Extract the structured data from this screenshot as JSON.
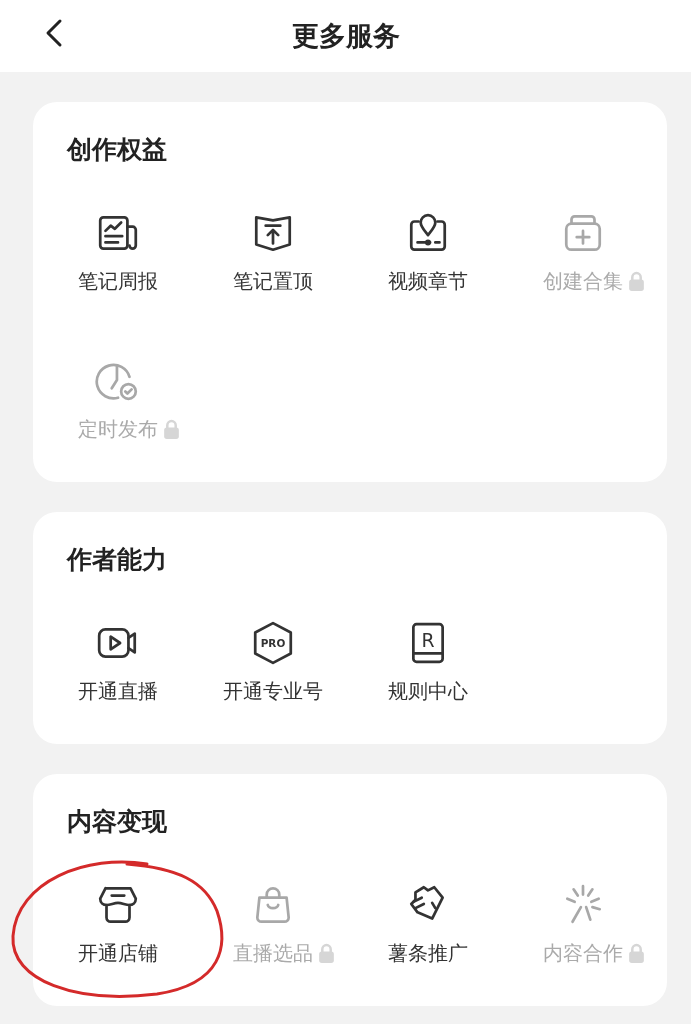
{
  "header": {
    "title": "更多服务"
  },
  "sections": [
    {
      "title": "创作权益",
      "items": [
        {
          "label": "笔记周报",
          "locked": false
        },
        {
          "label": "笔记置顶",
          "locked": false
        },
        {
          "label": "视频章节",
          "locked": false
        },
        {
          "label": "创建合集",
          "locked": true
        },
        {
          "label": "定时发布",
          "locked": true
        }
      ]
    },
    {
      "title": "作者能力",
      "items": [
        {
          "label": "开通直播",
          "locked": false
        },
        {
          "label": "开通专业号",
          "locked": false,
          "badge": "PRO"
        },
        {
          "label": "规则中心",
          "locked": false,
          "badge": "R"
        }
      ]
    },
    {
      "title": "内容变现",
      "items": [
        {
          "label": "开通店铺",
          "locked": false
        },
        {
          "label": "直播选品",
          "locked": true
        },
        {
          "label": "薯条推广",
          "locked": false
        },
        {
          "label": "内容合作",
          "locked": true
        }
      ]
    }
  ],
  "annotation": {
    "kind": "circle",
    "color": "#d42a2a"
  }
}
